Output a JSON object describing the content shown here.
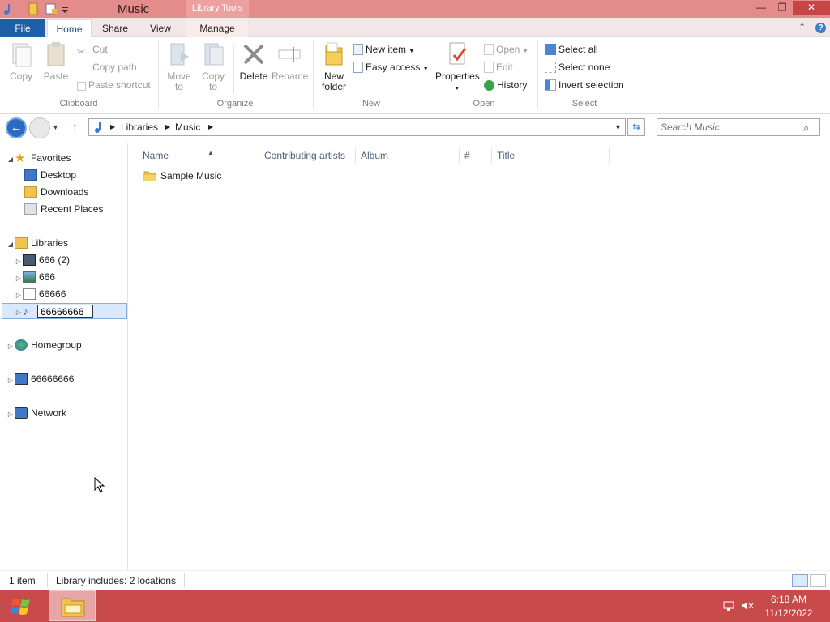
{
  "window": {
    "title": "Music",
    "context_tab": "Library Tools",
    "minimize_label": "—",
    "restore_label": "❐",
    "close_label": "✕"
  },
  "ribbon_tabs": {
    "file": "File",
    "home": "Home",
    "share": "Share",
    "view": "View",
    "manage": "Manage",
    "minimize_ribbon": "⌃",
    "help": "?"
  },
  "ribbon": {
    "clipboard": {
      "label": "Clipboard",
      "copy": "Copy",
      "paste": "Paste",
      "cut": "Cut",
      "copy_path": "Copy path",
      "paste_shortcut": "Paste shortcut"
    },
    "organize": {
      "label": "Organize",
      "move_to": "Move",
      "move_to_2": "to",
      "copy_to": "Copy",
      "copy_to_2": "to",
      "delete": "Delete",
      "rename": "Rename"
    },
    "new": {
      "label": "New",
      "new_folder": "New",
      "new_folder_2": "folder",
      "new_item": "New item",
      "easy_access": "Easy access"
    },
    "open": {
      "label": "Open",
      "properties": "Properties",
      "open": "Open",
      "edit": "Edit",
      "history": "History"
    },
    "select": {
      "label": "Select",
      "select_all": "Select all",
      "select_none": "Select none",
      "invert_selection": "Invert selection"
    }
  },
  "address": {
    "crumbs": [
      "Libraries",
      "Music"
    ],
    "search_placeholder": "Search Music"
  },
  "nav": {
    "favorites": "Favorites",
    "desktop": "Desktop",
    "downloads": "Downloads",
    "recent_places": "Recent Places",
    "libraries": "Libraries",
    "lib1": "666 (2)",
    "lib2": "666",
    "lib3": "66666",
    "lib4_rename": "66666666",
    "homegroup": "Homegroup",
    "computer": "66666666",
    "network": "Network"
  },
  "columns": {
    "name": "Name",
    "artists": "Contributing artists",
    "album": "Album",
    "number": "#",
    "title": "Title"
  },
  "files": [
    {
      "name": "Sample Music"
    }
  ],
  "status": {
    "count": "1 item",
    "info": "Library includes: 2 locations"
  },
  "clock": {
    "time": "6:18 AM",
    "date": "11/12/2022"
  },
  "colors": {
    "titlebar": "#e48c8c",
    "taskbar": "#c94a4a",
    "file_tab": "#1f5fa8",
    "selection": "#d9e8fb"
  }
}
